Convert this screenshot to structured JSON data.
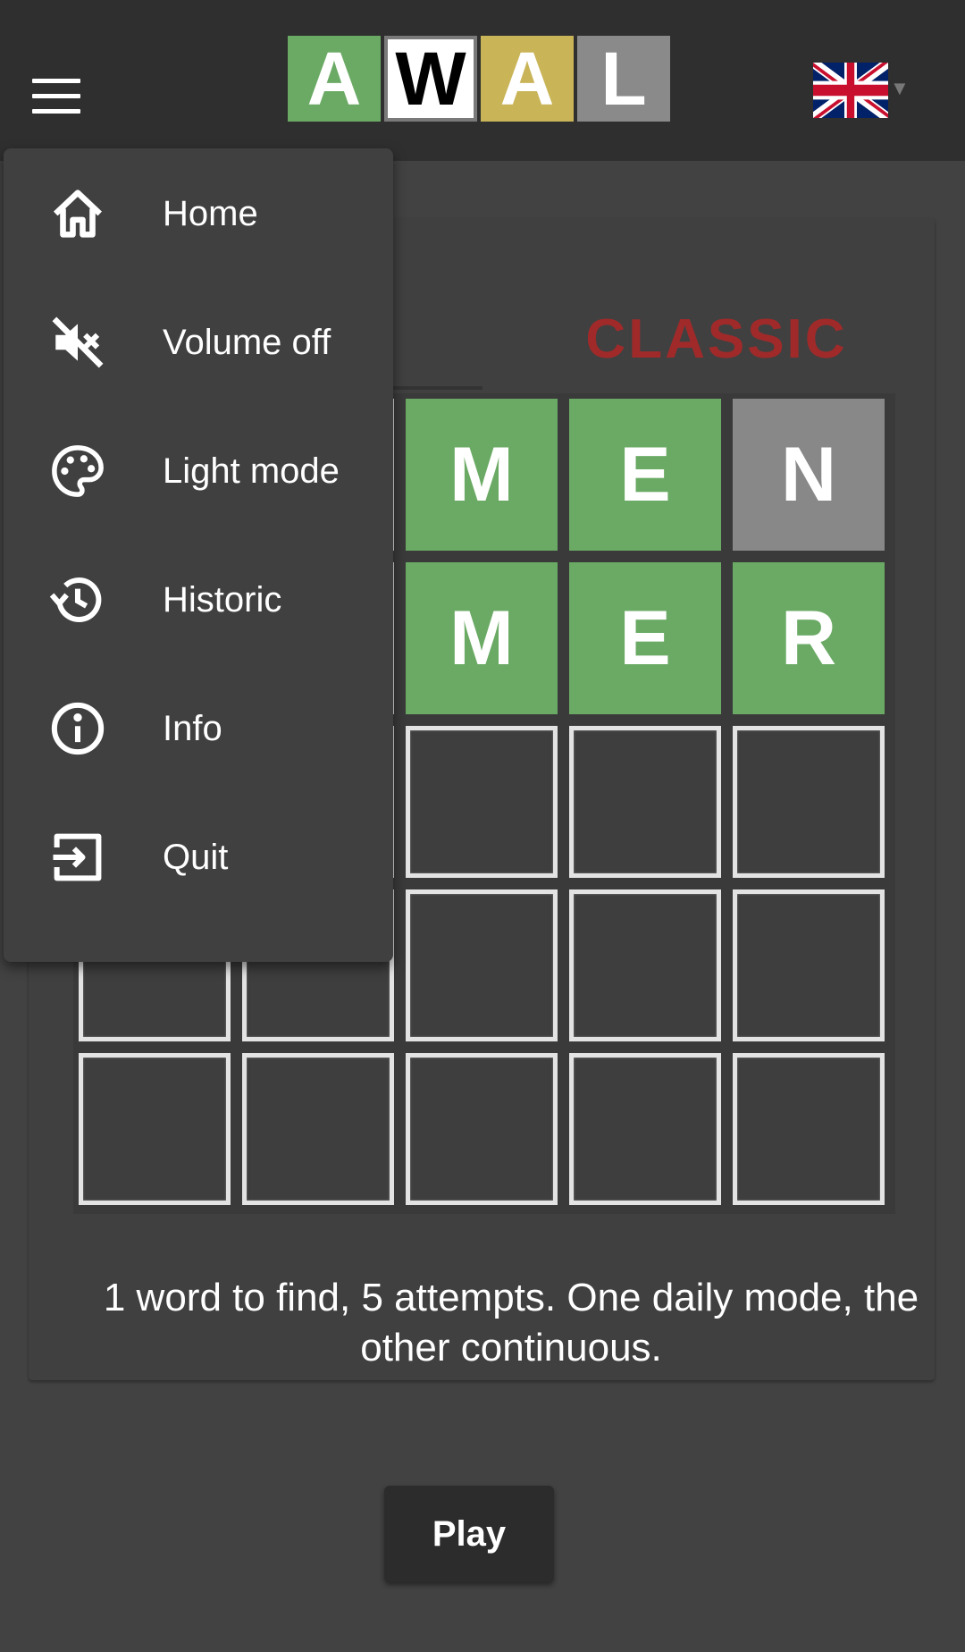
{
  "header": {
    "logo_letters": [
      "A",
      "W",
      "A",
      "L"
    ],
    "language_flag": "uk-flag-icon",
    "menu_icon": "hamburger-icon"
  },
  "menu": {
    "items": [
      {
        "label": "Home",
        "icon": "home-icon"
      },
      {
        "label": "Volume off",
        "icon": "volume-off-icon"
      },
      {
        "label": "Light mode",
        "icon": "palette-icon"
      },
      {
        "label": "Historic",
        "icon": "history-icon"
      },
      {
        "label": "Info",
        "icon": "info-icon"
      },
      {
        "label": "Quit",
        "icon": "exit-icon"
      }
    ]
  },
  "card": {
    "mode_tab": "CLASSIC",
    "description": "1 word to find, 5 attempts. One daily mode, the other continuous."
  },
  "grid": {
    "rows": [
      [
        {
          "letter": "",
          "state": "hidden"
        },
        {
          "letter": "",
          "state": "hidden"
        },
        {
          "letter": "M",
          "state": "correct"
        },
        {
          "letter": "E",
          "state": "correct"
        },
        {
          "letter": "N",
          "state": "absent"
        }
      ],
      [
        {
          "letter": "",
          "state": "hidden"
        },
        {
          "letter": "",
          "state": "hidden"
        },
        {
          "letter": "M",
          "state": "correct"
        },
        {
          "letter": "E",
          "state": "correct"
        },
        {
          "letter": "R",
          "state": "correct"
        }
      ],
      [
        {
          "letter": "",
          "state": "empty"
        },
        {
          "letter": "",
          "state": "empty"
        },
        {
          "letter": "",
          "state": "empty"
        },
        {
          "letter": "",
          "state": "empty"
        },
        {
          "letter": "",
          "state": "empty"
        }
      ],
      [
        {
          "letter": "",
          "state": "empty"
        },
        {
          "letter": "",
          "state": "empty"
        },
        {
          "letter": "",
          "state": "empty"
        },
        {
          "letter": "",
          "state": "empty"
        },
        {
          "letter": "",
          "state": "empty"
        }
      ],
      [
        {
          "letter": "",
          "state": "empty"
        },
        {
          "letter": "",
          "state": "empty"
        },
        {
          "letter": "",
          "state": "empty"
        },
        {
          "letter": "",
          "state": "empty"
        },
        {
          "letter": "",
          "state": "empty"
        }
      ]
    ]
  },
  "actions": {
    "play_label": "Play"
  },
  "colors": {
    "correct": "#6aaa64",
    "present": "#c9b458",
    "absent": "#888888",
    "classic_tab": "#a02a2a"
  }
}
